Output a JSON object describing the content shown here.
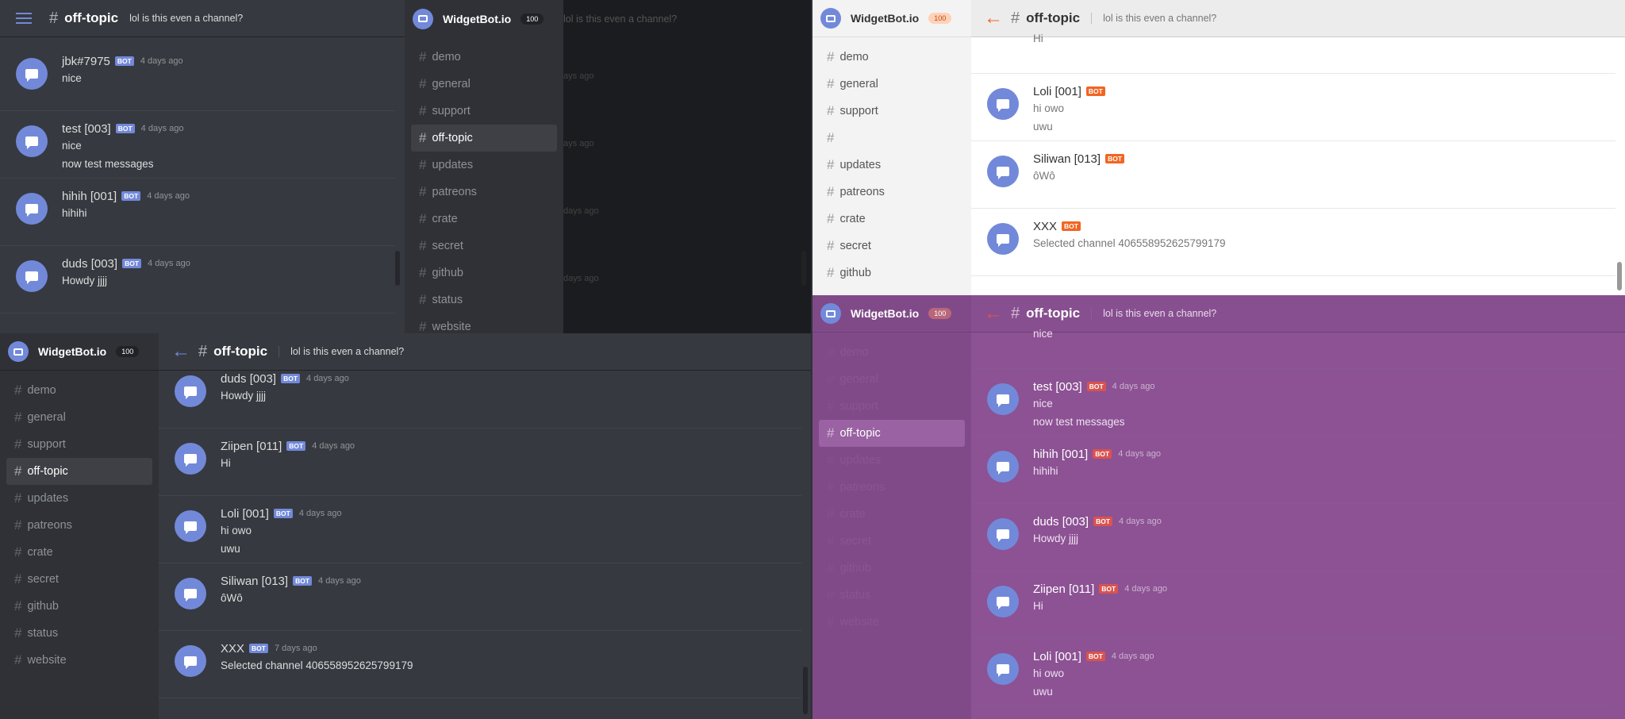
{
  "app": {
    "brand": "WidgetBot.io",
    "count": "100",
    "channel": "off-topic",
    "topic": "lol is this even a channel?",
    "bot_tag": "BOT"
  },
  "colors": {
    "accent": "#7289da",
    "orange": "#f26522",
    "purple": "#8c5294",
    "red_badge": "#d9534f"
  },
  "channels": [
    "demo",
    "general",
    "support",
    "off-topic",
    "updates",
    "patreons",
    "crate",
    "secret",
    "github",
    "status",
    "website"
  ],
  "channels_light": [
    "demo",
    "general",
    "support",
    "",
    "updates",
    "patreons",
    "crate",
    "secret",
    "github"
  ],
  "q1_messages": [
    {
      "name": "jbk#7975",
      "time": "4 days ago",
      "lines": [
        "nice"
      ],
      "avatar": "discord-icon"
    },
    {
      "name": "test [003]",
      "time": "4 days ago",
      "lines": [
        "nice",
        "now test messages"
      ]
    },
    {
      "name": "hihih [001]",
      "time": "4 days ago",
      "lines": [
        "hihihi"
      ]
    },
    {
      "name": "duds [003]",
      "time": "4 days ago",
      "lines": [
        "Howdy jjjj"
      ]
    }
  ],
  "q2_times": [
    "ays ago",
    "ays ago",
    "days ago",
    "days ago"
  ],
  "q3_messages": [
    {
      "name": "",
      "time": "",
      "lines": [
        "Hi"
      ]
    },
    {
      "name": "Loli [001]",
      "time": "",
      "lines": [
        "hi owo",
        "uwu"
      ]
    },
    {
      "name": "Siliwan [013]",
      "time": "",
      "lines": [
        "ôWô"
      ]
    },
    {
      "name": "XXX",
      "time": "",
      "lines": [
        "Selected channel 406558952625799179"
      ]
    }
  ],
  "q4_messages": [
    {
      "name": "duds [003]",
      "time": "4 days ago",
      "lines": [
        "Howdy jjjj"
      ]
    },
    {
      "name": "Ziipen [011]",
      "time": "4 days ago",
      "lines": [
        "Hi"
      ]
    },
    {
      "name": "Loli [001]",
      "time": "4 days ago",
      "lines": [
        "hi owo",
        "uwu"
      ]
    },
    {
      "name": "Siliwan [013]",
      "time": "4 days ago",
      "lines": [
        "ôWô"
      ]
    },
    {
      "name": "XXX",
      "time": "7 days ago",
      "lines": [
        "Selected channel 406558952625799179"
      ]
    }
  ],
  "q5_messages": [
    {
      "name": "",
      "time": "",
      "lines": [
        "nice"
      ]
    },
    {
      "name": "test [003]",
      "time": "4 days ago",
      "lines": [
        "nice",
        "now test messages"
      ]
    },
    {
      "name": "hihih [001]",
      "time": "4 days ago",
      "lines": [
        "hihihi"
      ]
    },
    {
      "name": "duds [003]",
      "time": "4 days ago",
      "lines": [
        "Howdy jjjj"
      ]
    },
    {
      "name": "Ziipen [011]",
      "time": "4 days ago",
      "lines": [
        "Hi"
      ]
    },
    {
      "name": "Loli [001]",
      "time": "4 days ago",
      "lines": [
        "hi owo",
        "uwu"
      ]
    }
  ]
}
